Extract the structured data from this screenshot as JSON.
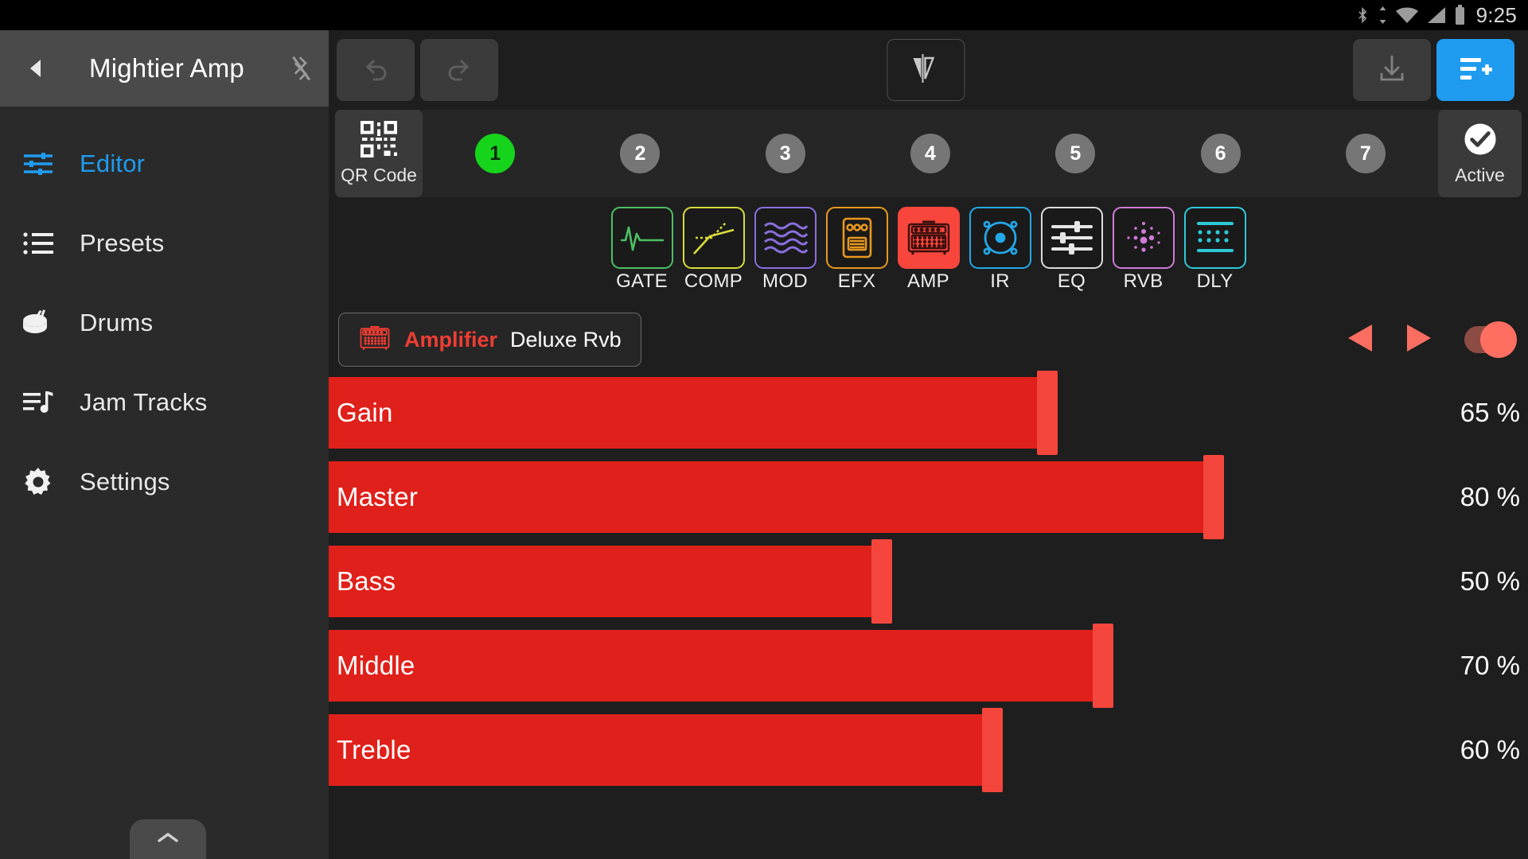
{
  "status_bar": {
    "icons": [
      "bluetooth-icon",
      "sync-arrows-icon",
      "wifi-icon",
      "cell-signal-icon",
      "battery-icon"
    ],
    "time": "9:25"
  },
  "sidebar": {
    "app_title": "Mightier Amp",
    "back_icon": "back-arrow-icon",
    "bluetooth_icon": "bluetooth-disabled-icon",
    "collapse_icon": "chevron-up-icon",
    "items": [
      {
        "label": "Editor",
        "icon": "sliders-icon",
        "active": true
      },
      {
        "label": "Presets",
        "icon": "list-icon",
        "active": false
      },
      {
        "label": "Drums",
        "icon": "drum-icon",
        "active": false
      },
      {
        "label": "Jam Tracks",
        "icon": "music-list-icon",
        "active": false
      },
      {
        "label": "Settings",
        "icon": "gear-icon",
        "active": false
      }
    ]
  },
  "toolbar": {
    "undo_icon": "undo-icon",
    "redo_icon": "redo-icon",
    "compare_icon": "ab-compare-icon",
    "save_icon": "download-icon",
    "add_preset_icon": "add-to-list-icon"
  },
  "channel_strip": {
    "qr_label": "QR Code",
    "qr_icon": "qr-code-icon",
    "channels": [
      {
        "label": "1",
        "selected": true
      },
      {
        "label": "2",
        "selected": false
      },
      {
        "label": "3",
        "selected": false
      },
      {
        "label": "4",
        "selected": false
      },
      {
        "label": "5",
        "selected": false
      },
      {
        "label": "6",
        "selected": false
      },
      {
        "label": "7",
        "selected": false
      }
    ],
    "active_label": "Active",
    "active_icon": "check-circle-icon"
  },
  "fx_chain": [
    {
      "label": "GATE",
      "icon": "gate-waveform-icon",
      "color": "#4dbf64",
      "selected": false
    },
    {
      "label": "COMP",
      "icon": "compressor-curve-icon",
      "color": "#d8dd3a",
      "selected": false
    },
    {
      "label": "MOD",
      "icon": "modulation-waves-icon",
      "color": "#8b6fe0",
      "selected": false
    },
    {
      "label": "EFX",
      "icon": "pedal-icon",
      "color": "#e8981e",
      "selected": false
    },
    {
      "label": "AMP",
      "icon": "amplifier-icon",
      "color": "#f8463c",
      "selected": true
    },
    {
      "label": "IR",
      "icon": "speaker-cab-icon",
      "color": "#23a8e8",
      "selected": false
    },
    {
      "label": "EQ",
      "icon": "equalizer-icon",
      "color": "#dcdcdc",
      "selected": false
    },
    {
      "label": "RVB",
      "icon": "reverb-dots-icon",
      "color": "#d07ad8",
      "selected": false
    },
    {
      "label": "DLY",
      "icon": "delay-grid-icon",
      "color": "#2ec9d8",
      "selected": false
    }
  ],
  "module": {
    "icon": "amplifier-icon",
    "type_label": "Amplifier",
    "name": "Deluxe Rvb",
    "prev_icon": "prev-triangle-icon",
    "next_icon": "next-triangle-icon",
    "enabled": true,
    "accent_color": "#ff6f61"
  },
  "parameters": [
    {
      "label": "Gain",
      "value": 65,
      "display": "65 %"
    },
    {
      "label": "Master",
      "value": 80,
      "display": "80 %"
    },
    {
      "label": "Bass",
      "value": 50,
      "display": "50 %"
    },
    {
      "label": "Middle",
      "value": 70,
      "display": "70 %"
    },
    {
      "label": "Treble",
      "value": 60,
      "display": "60 %"
    }
  ]
}
